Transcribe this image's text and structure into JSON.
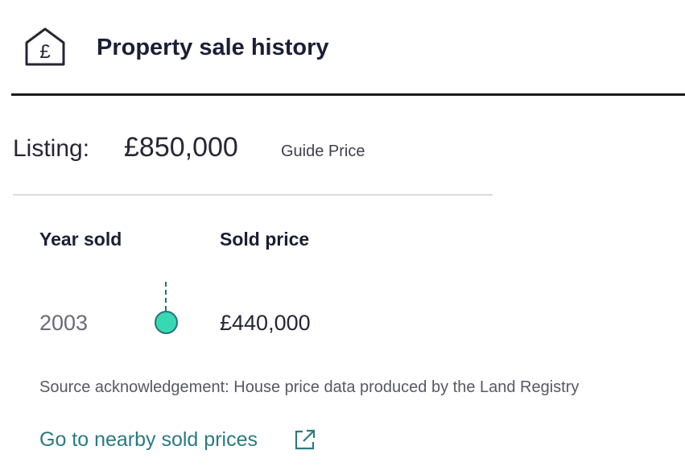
{
  "header": {
    "icon": "house-pound-icon",
    "title": "Property sale history"
  },
  "listing": {
    "label": "Listing:",
    "price": "£850,000",
    "qualifier": "Guide Price"
  },
  "table": {
    "columns": [
      "Year sold",
      "Sold price"
    ],
    "rows": [
      {
        "year": "2003",
        "price": "£440,000"
      }
    ]
  },
  "source_note": "Source acknowledgement: House price data produced by the Land Registry",
  "nearby_link": {
    "label": "Go to nearby sold prices",
    "icon": "external-link-icon"
  },
  "colors": {
    "accent": "#2b7a82",
    "dot_fill": "#37d9b4",
    "text": "#262637"
  }
}
